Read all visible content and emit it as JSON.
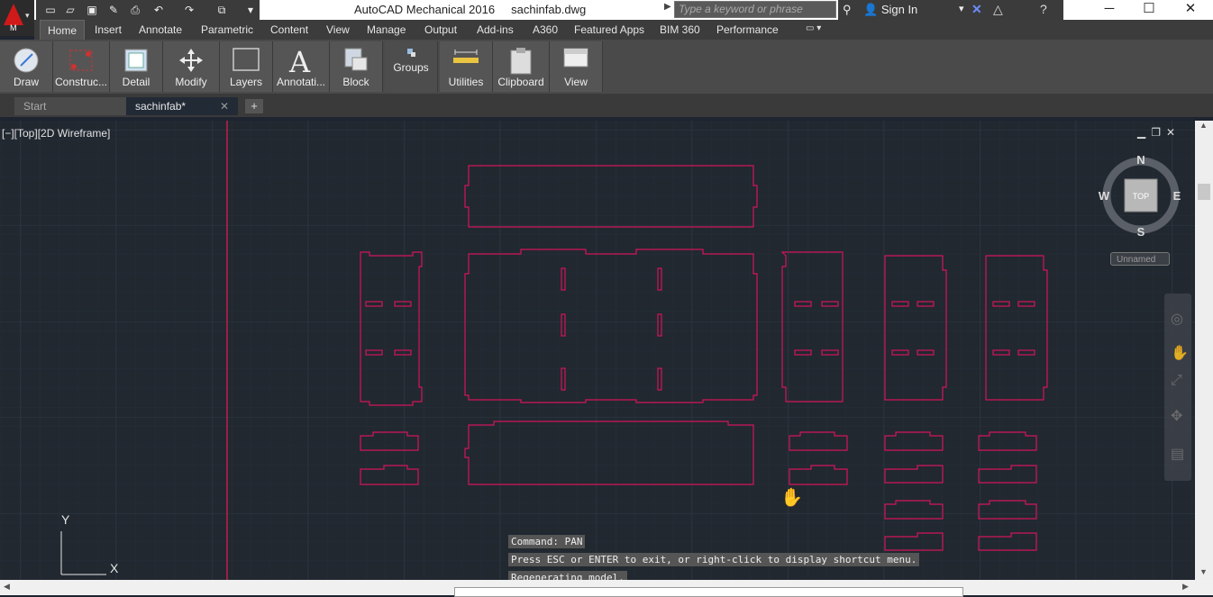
{
  "window": {
    "app_title": "AutoCAD Mechanical 2016",
    "file_name": "sachinfab.dwg",
    "search_placeholder": "Type a keyword or phrase",
    "sign_in": "Sign In",
    "logo_letter": "M"
  },
  "menu": {
    "tabs": [
      "Home",
      "Insert",
      "Annotate",
      "Parametric",
      "Content",
      "View",
      "Manage",
      "Output",
      "Add-ins",
      "A360",
      "Featured Apps",
      "BIM 360",
      "Performance"
    ]
  },
  "ribbon": {
    "panels": [
      "Draw",
      "Construc...",
      "Detail",
      "Modify",
      "Layers",
      "Annotati...",
      "Block",
      "Groups",
      "Utilities",
      "Clipboard",
      "View"
    ]
  },
  "doc_tabs": {
    "start": "Start",
    "file": "sachinfab*"
  },
  "viewport": {
    "label": "[−][Top][2D Wireframe]",
    "viewcube": {
      "n": "N",
      "s": "S",
      "e": "E",
      "w": "W",
      "face": "TOP"
    },
    "wcs": "Unnamed",
    "ucs_x": "X",
    "ucs_y": "Y"
  },
  "command": {
    "lines": [
      "Command: PAN",
      "Press ESC or ENTER to exit, or right-click to display shortcut menu.",
      "Regenerating model."
    ]
  },
  "colors": {
    "geometry": "#d4145a",
    "background": "#212830",
    "grid": "#2b3340"
  }
}
